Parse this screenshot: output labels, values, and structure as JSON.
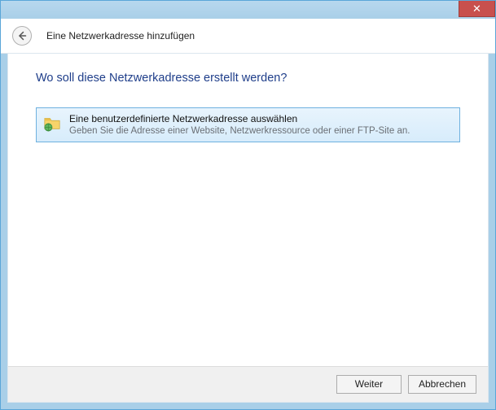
{
  "window": {
    "close_glyph": "✕"
  },
  "header": {
    "title": "Eine Netzwerkadresse hinzufügen"
  },
  "main": {
    "heading": "Wo soll diese Netzwerkadresse erstellt werden?",
    "option": {
      "title": "Eine benutzerdefinierte Netzwerkadresse auswählen",
      "subtitle": "Geben Sie die Adresse einer Website, Netzwerkressource oder einer FTP-Site an."
    }
  },
  "footer": {
    "next_label": "Weiter",
    "cancel_label": "Abbrechen"
  }
}
